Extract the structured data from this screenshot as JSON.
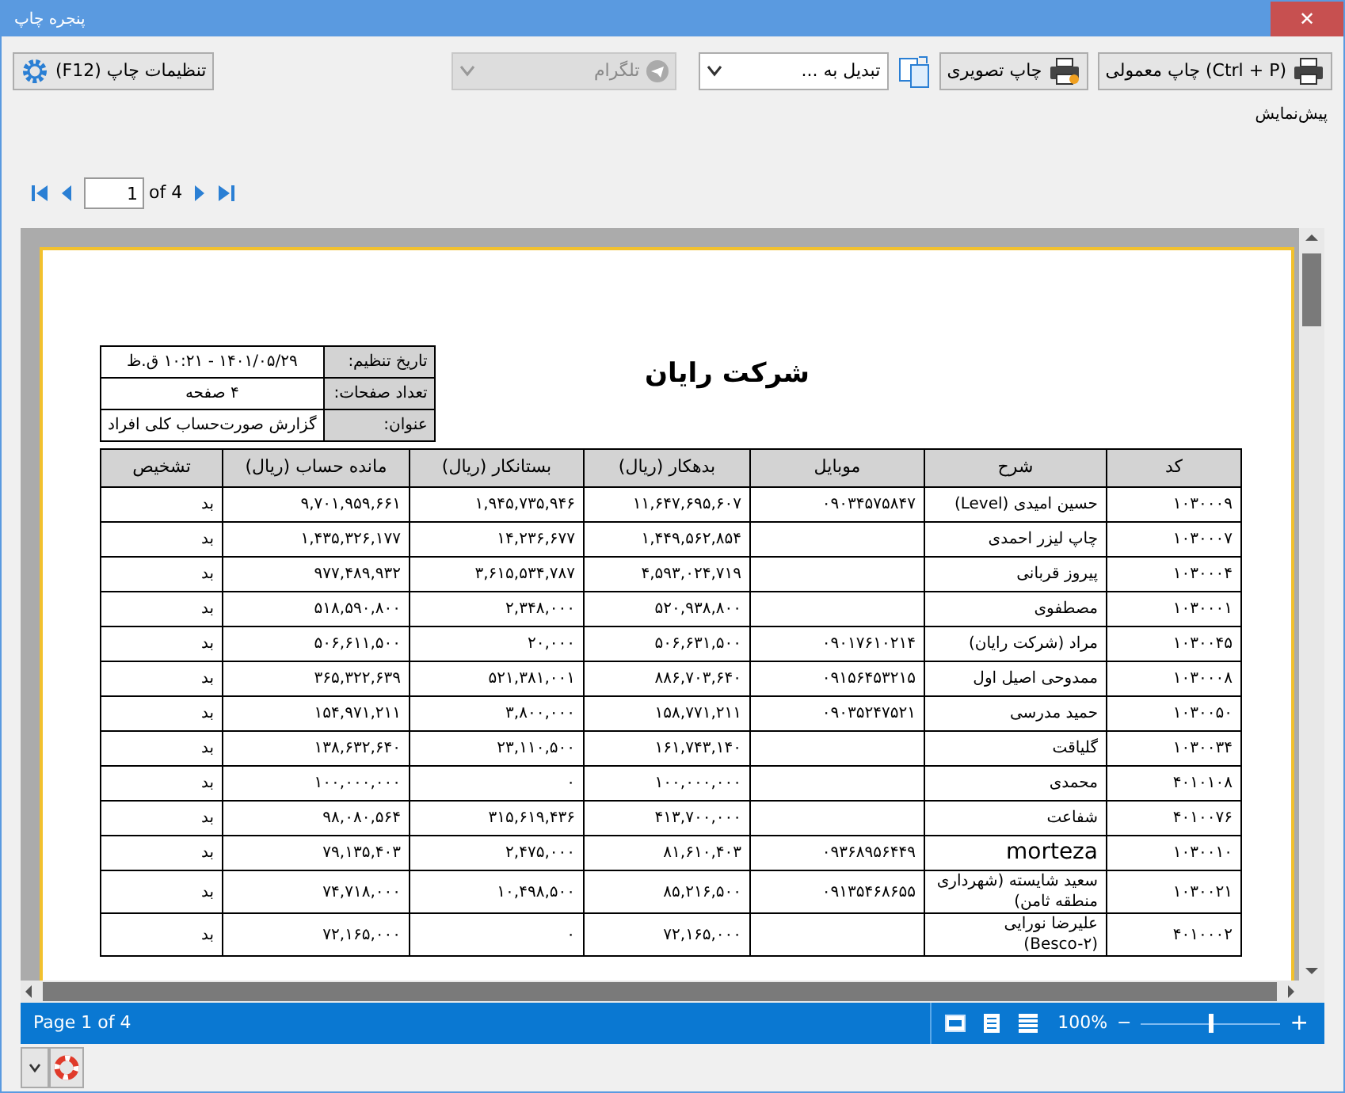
{
  "window": {
    "title": "پنجره چاپ",
    "close": "✕"
  },
  "toolbar": {
    "settings_button": "تنظیمات چاپ (F12)",
    "telegram": {
      "label": "تلگرام",
      "disabled": true
    },
    "convert": {
      "label": "تبدیل به ...",
      "disabled": false
    },
    "image_print_button": "چاپ تصویری",
    "normal_print_button": "چاپ معمولی (Ctrl + P)"
  },
  "preview_label": "پیش‌نمایش",
  "pager": {
    "page": "1",
    "of": "of 4"
  },
  "report": {
    "title": "شرکت رایان",
    "info": [
      {
        "label": "تاریخ تنظیم:",
        "value": "۱۴۰۱/۰۵/۲۹ - ۱۰:۲۱ ق.ظ"
      },
      {
        "label": "تعداد صفحات:",
        "value": "۴ صفحه"
      },
      {
        "label": "عنوان:",
        "value": "گزارش صورت‌حساب کلی افراد"
      }
    ],
    "columns": [
      "کد",
      "شرح",
      "موبایل",
      "بدهکار (ریال)",
      "بستانکار (ریال)",
      "مانده حساب (ریال)",
      "تشخیص"
    ],
    "rows": [
      {
        "code": "۱۰۳۰۰۰۹",
        "description": "حسین امیدی (Level)",
        "mobile": "۰۹۰۳۴۵۷۵۸۴۷",
        "debit": "۱۱,۶۴۷,۶۹۵,۶۰۷",
        "credit": "۱,۹۴۵,۷۳۵,۹۴۶",
        "balance": "۹,۷۰۱,۹۵۹,۶۶۱",
        "status": "بد"
      },
      {
        "code": "۱۰۳۰۰۰۷",
        "description": "چاپ لیزر احمدی",
        "debit": "۱,۴۴۹,۵۶۲,۸۵۴",
        "credit": "۱۴,۲۳۶,۶۷۷",
        "balance": "۱,۴۳۵,۳۲۶,۱۷۷",
        "status": "بد"
      },
      {
        "code": "۱۰۳۰۰۰۴",
        "description": "پیروز قربانی",
        "debit": "۴,۵۹۳,۰۲۴,۷۱۹",
        "credit": "۳,۶۱۵,۵۳۴,۷۸۷",
        "balance": "۹۷۷,۴۸۹,۹۳۲",
        "status": "بد"
      },
      {
        "code": "۱۰۳۰۰۰۱",
        "description": "مصطفوی",
        "debit": "۵۲۰,۹۳۸,۸۰۰",
        "credit": "۲,۳۴۸,۰۰۰",
        "balance": "۵۱۸,۵۹۰,۸۰۰",
        "status": "بد"
      },
      {
        "code": "۱۰۳۰۰۴۵",
        "description": "مراد (شرکت رایان)",
        "mobile": "۰۹۰۱۷۶۱۰۲۱۴",
        "debit": "۵۰۶,۶۳۱,۵۰۰",
        "credit": "۲۰,۰۰۰",
        "balance": "۵۰۶,۶۱۱,۵۰۰",
        "status": "بد"
      },
      {
        "code": "۱۰۳۰۰۰۸",
        "description": "ممدوحی اصیل اول",
        "mobile": "۰۹۱۵۶۴۵۳۲۱۵",
        "debit": "۸۸۶,۷۰۳,۶۴۰",
        "credit": "۵۲۱,۳۸۱,۰۰۱",
        "balance": "۳۶۵,۳۲۲,۶۳۹",
        "status": "بد"
      },
      {
        "code": "۱۰۳۰۰۵۰",
        "description": "حمید مدرسی",
        "mobile": "۰۹۰۳۵۲۴۷۵۲۱",
        "debit": "۱۵۸,۷۷۱,۲۱۱",
        "credit": "۳,۸۰۰,۰۰۰",
        "balance": "۱۵۴,۹۷۱,۲۱۱",
        "status": "بد"
      },
      {
        "code": "۱۰۳۰۰۳۴",
        "description": "گلیاقت",
        "debit": "۱۶۱,۷۴۳,۱۴۰",
        "credit": "۲۳,۱۱۰,۵۰۰",
        "balance": "۱۳۸,۶۳۲,۶۴۰",
        "status": "بد"
      },
      {
        "code": "۴۰۱۰۱۰۸",
        "description": "محمدی",
        "debit": "۱۰۰,۰۰۰,۰۰۰",
        "credit": "۰",
        "balance": "۱۰۰,۰۰۰,۰۰۰",
        "status": "بد"
      },
      {
        "code": "۴۰۱۰۰۷۶",
        "description": "شفاعت",
        "debit": "۴۱۳,۷۰۰,۰۰۰",
        "credit": "۳۱۵,۶۱۹,۴۳۶",
        "balance": "۹۸,۰۸۰,۵۶۴",
        "status": "بد"
      },
      {
        "code": "۱۰۳۰۰۱۰",
        "description": "morteza",
        "mobile": "۰۹۳۶۸۹۵۶۴۴۹",
        "debit": "۸۱,۶۱۰,۴۰۳",
        "credit": "۲,۴۷۵,۰۰۰",
        "balance": "۷۹,۱۳۵,۴۰۳",
        "status": "بد"
      },
      {
        "code": "۱۰۳۰۰۲۱",
        "description": "سعید شایسته (شهرداری منطقه ثامن)",
        "mobile": "۰۹۱۳۵۴۶۸۶۵۵",
        "debit": "۸۵,۲۱۶,۵۰۰",
        "credit": "۱۰,۴۹۸,۵۰۰",
        "balance": "۷۴,۷۱۸,۰۰۰",
        "status": "بد"
      },
      {
        "code": "۴۰۱۰۰۰۲",
        "description": "علیرضا نورایی (Besco-۲)",
        "debit": "۷۲,۱۶۵,۰۰۰",
        "credit": "۰",
        "balance": "۷۲,۱۶۵,۰۰۰",
        "status": "بد"
      }
    ]
  },
  "status_bar": {
    "page": "Page 1 of 4",
    "zoom": "100%",
    "minus": "−",
    "plus": "+",
    "zoom_slider": {
      "level": 0.5
    }
  }
}
